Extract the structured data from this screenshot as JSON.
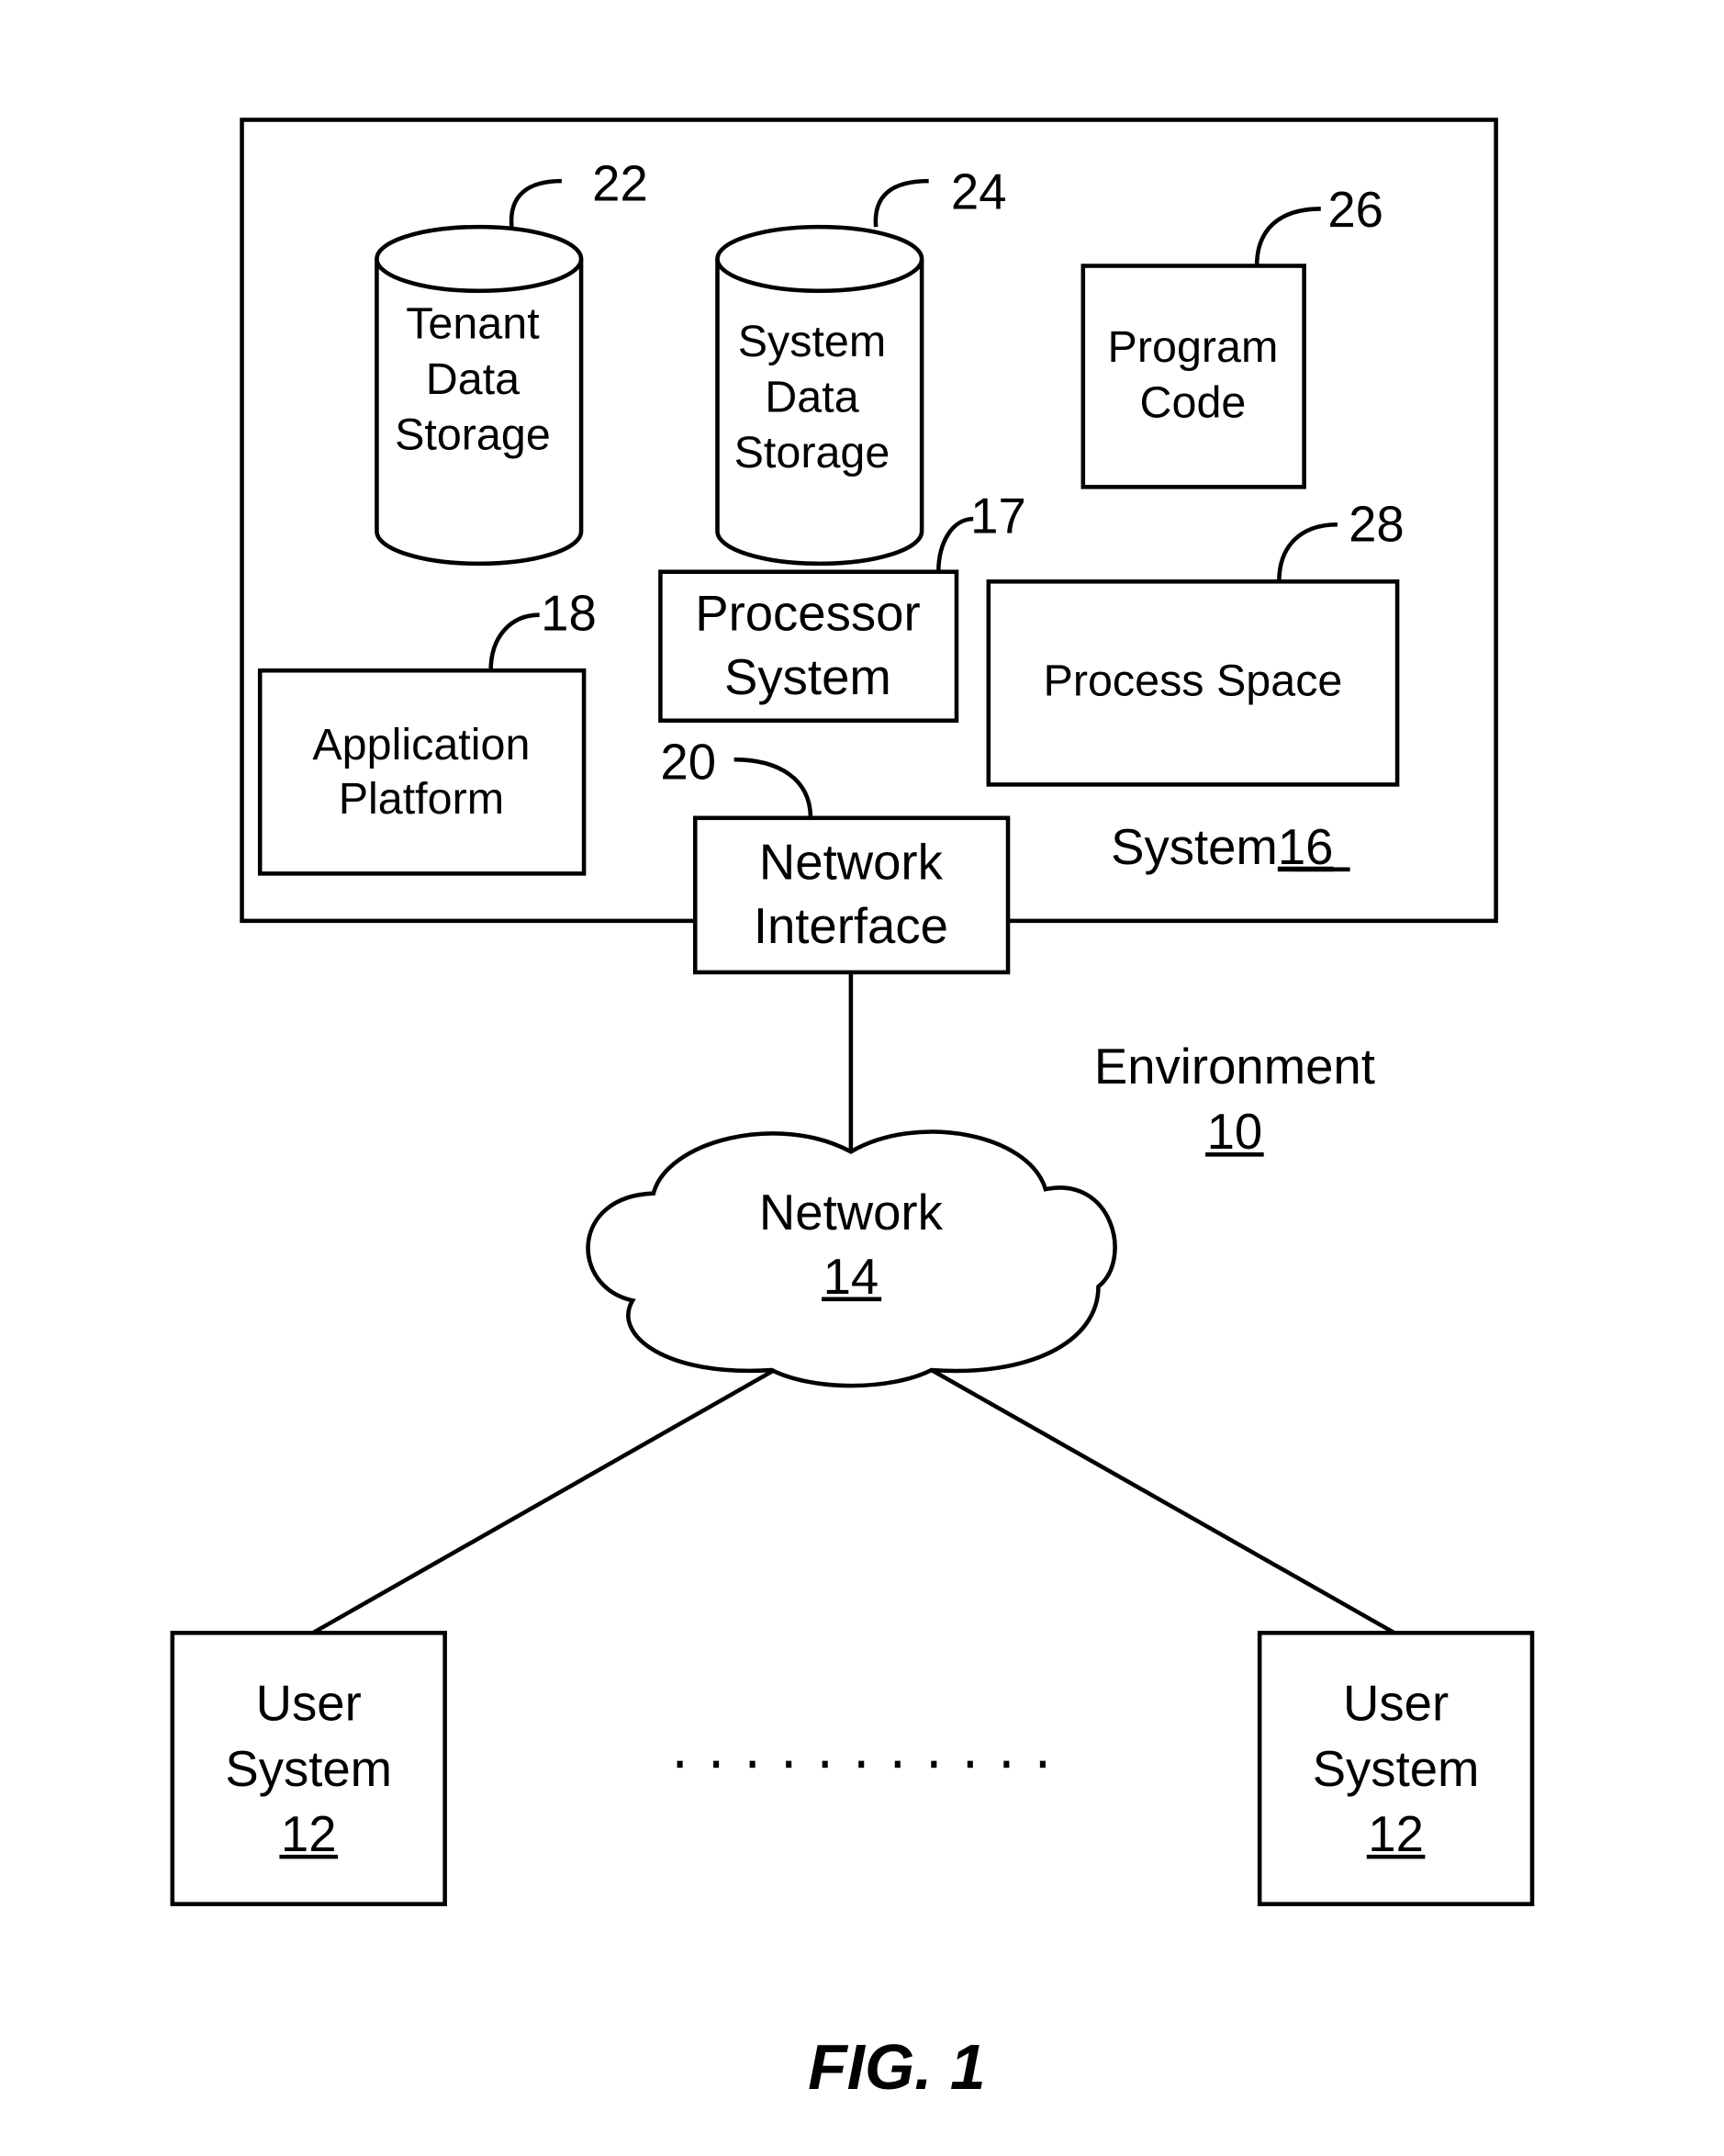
{
  "figure_label": "FIG. 1",
  "system": {
    "label": "System",
    "ref": "16"
  },
  "environment": {
    "label": "Environment",
    "ref": "10"
  },
  "components": {
    "tenant_data_storage": {
      "lines": [
        "Tenant",
        "Data",
        "Storage"
      ],
      "ref": "22"
    },
    "system_data_storage": {
      "lines": [
        "System",
        "Data",
        "Storage"
      ],
      "ref": "24"
    },
    "program_code": {
      "lines": [
        "Program",
        "Code"
      ],
      "ref": "26"
    },
    "processor_system": {
      "lines": [
        "Processor",
        "System"
      ],
      "ref": "17"
    },
    "process_space": {
      "lines": [
        "Process Space"
      ],
      "ref": "28"
    },
    "application_platform": {
      "lines": [
        "Application",
        "Platform"
      ],
      "ref": "18"
    },
    "network_interface": {
      "lines": [
        "Network",
        "Interface"
      ],
      "ref": "20"
    }
  },
  "network": {
    "label": "Network",
    "ref": "14"
  },
  "user_systems": [
    {
      "lines": [
        "User",
        "System"
      ],
      "ref": "12"
    },
    {
      "lines": [
        "User",
        "System"
      ],
      "ref": "12"
    }
  ],
  "ellipsis_dots": 11
}
